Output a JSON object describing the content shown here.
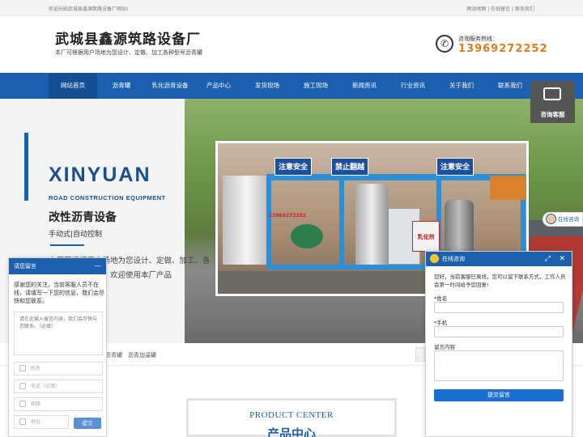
{
  "topbar": {
    "welcome": "欢迎光临武城县鑫源筑路设备厂网站!",
    "links": "网站地图 | 在线留言 | 联系我们"
  },
  "header": {
    "title": "武城县鑫源筑路设备厂",
    "subtitle": "本厂可根据用户场地为您设计、定做、加工各种型号沥青罐",
    "phone_label": "咨询服务热线：",
    "phone_number": "13969272252"
  },
  "nav": {
    "items": [
      {
        "label": "网站首页"
      },
      {
        "label": "沥青罐"
      },
      {
        "label": "乳化沥青设备"
      },
      {
        "label": "产品中心"
      },
      {
        "label": "发货现场"
      },
      {
        "label": "施工现场"
      },
      {
        "label": "新闻资讯"
      },
      {
        "label": "行业资讯"
      },
      {
        "label": "关于我们"
      },
      {
        "label": "联系我们"
      }
    ],
    "active_index": 0
  },
  "banner": {
    "brand": "XINYUAN",
    "brand_sub": "ROAD CONSTRUCTION EQUIPMENT",
    "headline": "改性沥青设备",
    "mode": "手动式|自动控制",
    "description": "本厂可根据用户场地为您设计、定做、加工、各种型号的沥青罐，欢迎使用本厂产品",
    "photo_signs": [
      "注意安全",
      "禁止翻越",
      "注意安全"
    ],
    "photo_phone": "13969272252",
    "photo_label": "乳化剂",
    "slides_total": 3,
    "slide_active": 1
  },
  "widgets": {
    "consult_label": "咨询客服",
    "online_label": "在线咨询"
  },
  "tags": {
    "items": [
      "沥青罐",
      "沥青加温罐"
    ]
  },
  "product_center": {
    "en": "PRODUCT CENTER",
    "cn": "产品中心"
  },
  "leave_box": {
    "title": "请您留言",
    "message": "感谢您的关注，当前客服人员不在线，请填写一下您的信息，我们会尽快和您联系。",
    "textarea_placeholder": "请在此输入留言内容，我们会尽快与您联系。（必填）",
    "name_placeholder": "姓名",
    "phone_placeholder": "电话（必填）",
    "email_placeholder": "邮箱",
    "address_placeholder": "地址",
    "submit": "提交"
  },
  "chat_box": {
    "title": "在线咨询",
    "message": "您好，当前客服已离线，您可以留下联系方式，工作人员会第一时间给予您回复!",
    "name_label": "*姓名",
    "phone_label": "*手机",
    "content_label": "留言内容",
    "submit": "提交留言"
  },
  "colors": {
    "brand_blue": "#1b5fae",
    "phone_orange": "#e07a1b"
  }
}
